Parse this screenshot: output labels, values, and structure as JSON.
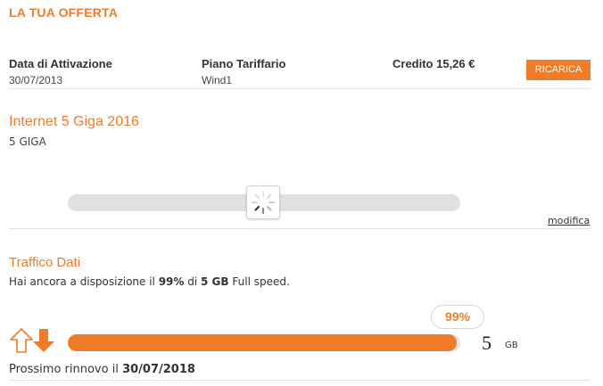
{
  "header": {
    "title": "LA TUA OFFERTA"
  },
  "account": {
    "activation_label": "Data di Attivazione",
    "activation_date": "30/07/2013",
    "plan_label": "Piano Tariffario",
    "plan_value": "Wind1",
    "credit_text": "Credito 15,26 €",
    "recharge_button": "RICARICA"
  },
  "offer": {
    "name": "Internet 5 Giga 2016",
    "size": "5 GIGA",
    "modify_link": "modifica"
  },
  "traffic": {
    "title": "Traffico Dati",
    "text_prefix": "Hai ancora a disposizione il ",
    "percent_text": "99%",
    "text_middle": " di ",
    "amount_text": "5 GB",
    "text_suffix": " Full speed.",
    "bubble": "99%",
    "remaining_fraction": 0.99,
    "total_number": "5",
    "total_unit": "GB",
    "renewal_prefix": "Prossimo rinnovo il ",
    "renewal_date": "30/07/2018"
  },
  "icons": {
    "loading": "loading-spinner-icon",
    "traffic": "upload-download-arrows-icon"
  },
  "colors": {
    "accent": "#f07c2a",
    "track": "#e0e0e0",
    "divider": "#e3e3e3"
  }
}
